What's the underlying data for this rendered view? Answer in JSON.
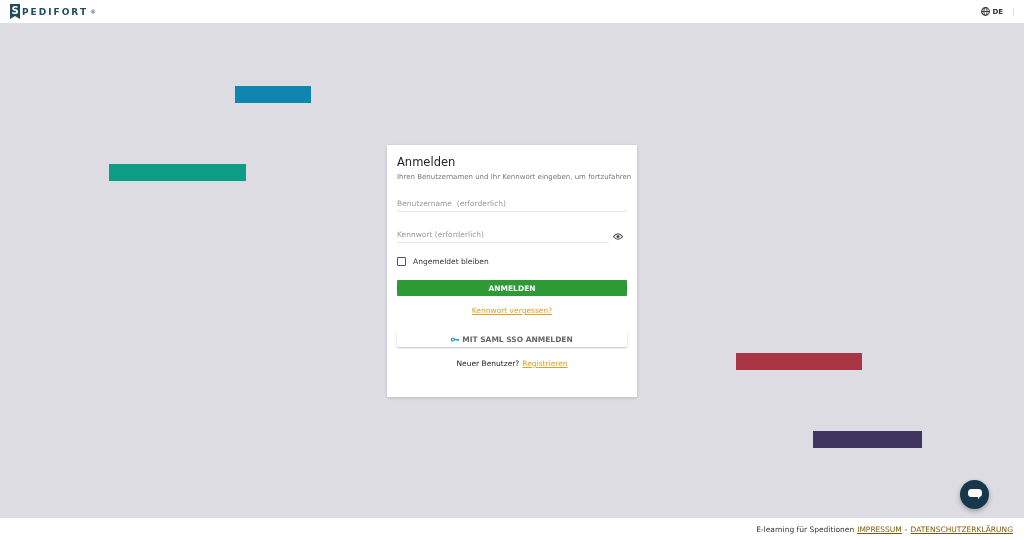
{
  "header": {
    "logo": {
      "initial": "S",
      "rest": "PEDIFORT",
      "mark": "®"
    },
    "language": "DE"
  },
  "login": {
    "title": "Anmelden",
    "subtitle": "Ihren Benutzernamen und Ihr Kennwort eingeben, um fortzufahren",
    "username": {
      "placeholder": "Benutzername  (erforderlich)"
    },
    "password": {
      "placeholder": "Kennwort (erforderlich)"
    },
    "remember": {
      "label": "Angemeldet bleiben",
      "checked": false
    },
    "submit": "ANMELDEN",
    "forgot": "Kennwort vergessen?",
    "sso": "MIT SAML SSO ANMELDEN",
    "register_prompt": "Neuer Benutzer?",
    "register_link": "Registrieren"
  },
  "footer": {
    "text": "E-learning für Speditionen",
    "links": [
      "IMPRESSUM",
      "DATENSCHUTZERKLÄRUNG"
    ],
    "separator": "-"
  }
}
